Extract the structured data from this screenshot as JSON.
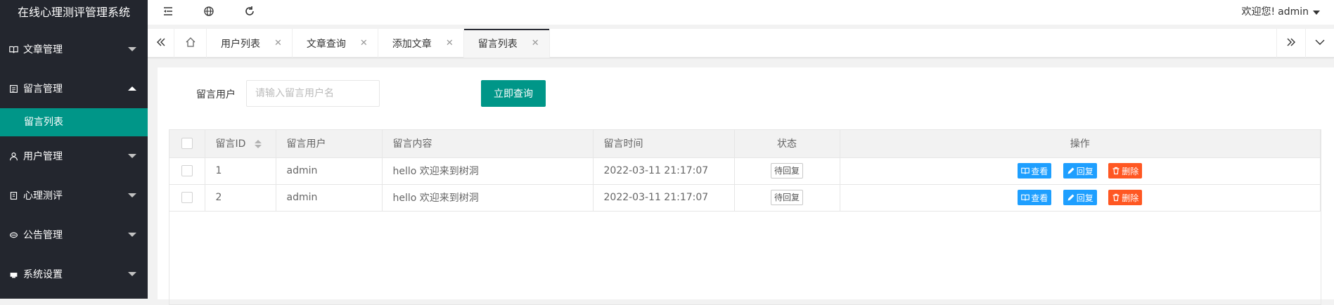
{
  "app": {
    "title": "在线心理测评管理系统"
  },
  "sidebar": {
    "items": [
      {
        "label": "文章管理",
        "icon": "book-icon",
        "state": "collapsed"
      },
      {
        "label": "留言管理",
        "icon": "message-icon",
        "state": "expanded",
        "children": [
          {
            "label": "留言列表",
            "active": true
          }
        ]
      },
      {
        "label": "用户管理",
        "icon": "user-icon",
        "state": "collapsed"
      },
      {
        "label": "心理测评",
        "icon": "form-icon",
        "state": "collapsed"
      },
      {
        "label": "公告管理",
        "icon": "notice-icon",
        "state": "collapsed"
      },
      {
        "label": "系统设置",
        "icon": "settings-icon",
        "state": "collapsed"
      }
    ]
  },
  "header": {
    "buttons": [
      "menu-toggle-icon",
      "globe-icon",
      "refresh-icon"
    ],
    "welcome": "欢迎您!",
    "user": "admin"
  },
  "tabs": [
    {
      "label": "用户列表"
    },
    {
      "label": "文章查询"
    },
    {
      "label": "添加文章"
    },
    {
      "label": "留言列表",
      "active": true
    }
  ],
  "search": {
    "label": "留言用户",
    "placeholder": "请输入留言用户名",
    "button": "立即查询"
  },
  "table": {
    "columns": [
      "留言ID",
      "留言用户",
      "留言内容",
      "留言时间",
      "状态",
      "操作"
    ],
    "rows": [
      {
        "id": "1",
        "user": "admin",
        "content": "hello 欢迎来到树洞",
        "time": "2022-03-11 21:17:07",
        "status": "待回复"
      },
      {
        "id": "2",
        "user": "admin",
        "content": "hello 欢迎来到树洞",
        "time": "2022-03-11 21:17:07",
        "status": "待回复"
      }
    ],
    "actions": {
      "view": "查看",
      "reply": "回复",
      "delete": "删除"
    }
  },
  "colors": {
    "sidebar_bg": "#23262e",
    "accent": "#009688",
    "action_blue": "#1e9fff",
    "action_red": "#ff5722"
  }
}
